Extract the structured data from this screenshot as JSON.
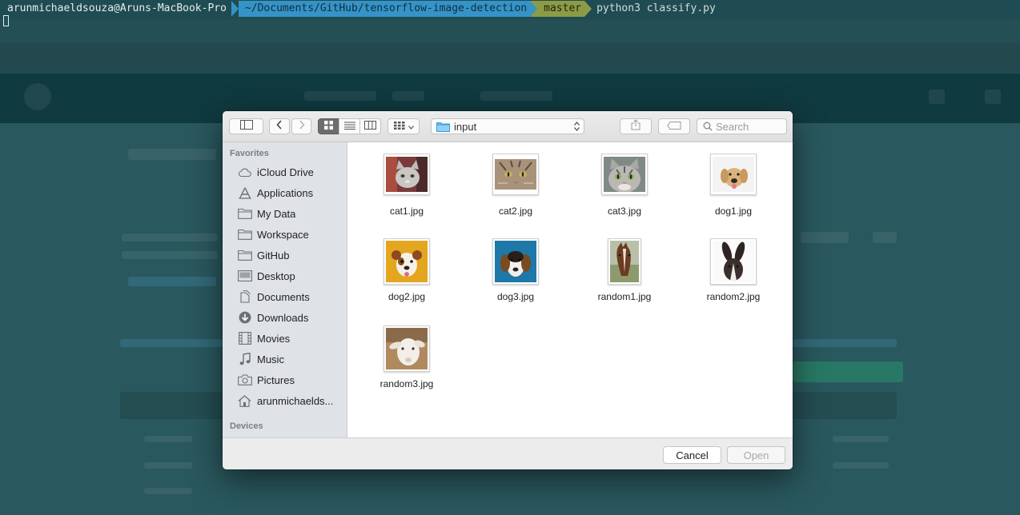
{
  "terminal": {
    "user_host": "arunmichaeldsouza@Aruns-MacBook-Pro",
    "path": "~/Documents/GitHub/tensorflow-image-detection",
    "branch_glyph": "",
    "branch": "master",
    "command": "python3 classify.py"
  },
  "dialog": {
    "toolbar": {
      "location": "input",
      "search_placeholder": "Search"
    },
    "sidebar": {
      "favorites_title": "Favorites",
      "items": [
        {
          "label": "iCloud Drive",
          "icon": "cloud-icon"
        },
        {
          "label": "Applications",
          "icon": "applications-icon"
        },
        {
          "label": "My Data",
          "icon": "folder-icon"
        },
        {
          "label": "Workspace",
          "icon": "folder-icon"
        },
        {
          "label": "GitHub",
          "icon": "folder-icon"
        },
        {
          "label": "Desktop",
          "icon": "desktop-icon"
        },
        {
          "label": "Documents",
          "icon": "documents-icon"
        },
        {
          "label": "Downloads",
          "icon": "downloads-icon"
        },
        {
          "label": "Movies",
          "icon": "movies-icon"
        },
        {
          "label": "Music",
          "icon": "music-icon"
        },
        {
          "label": "Pictures",
          "icon": "camera-icon"
        },
        {
          "label": "arunmichaelds...",
          "icon": "home-icon"
        }
      ],
      "devices_title": "Devices"
    },
    "files": [
      {
        "name": "cat1.jpg"
      },
      {
        "name": "cat2.jpg"
      },
      {
        "name": "cat3.jpg"
      },
      {
        "name": "dog1.jpg"
      },
      {
        "name": "dog2.jpg"
      },
      {
        "name": "dog3.jpg"
      },
      {
        "name": "random1.jpg"
      },
      {
        "name": "random2.jpg"
      },
      {
        "name": "random3.jpg"
      }
    ],
    "footer": {
      "cancel_label": "Cancel",
      "open_label": "Open"
    }
  },
  "colors": {
    "path_segment": "#3593c7",
    "git_segment": "#8e9b46",
    "sidebar_bg": "#dfe3e7",
    "folder_accent": "#5ab4f0"
  }
}
